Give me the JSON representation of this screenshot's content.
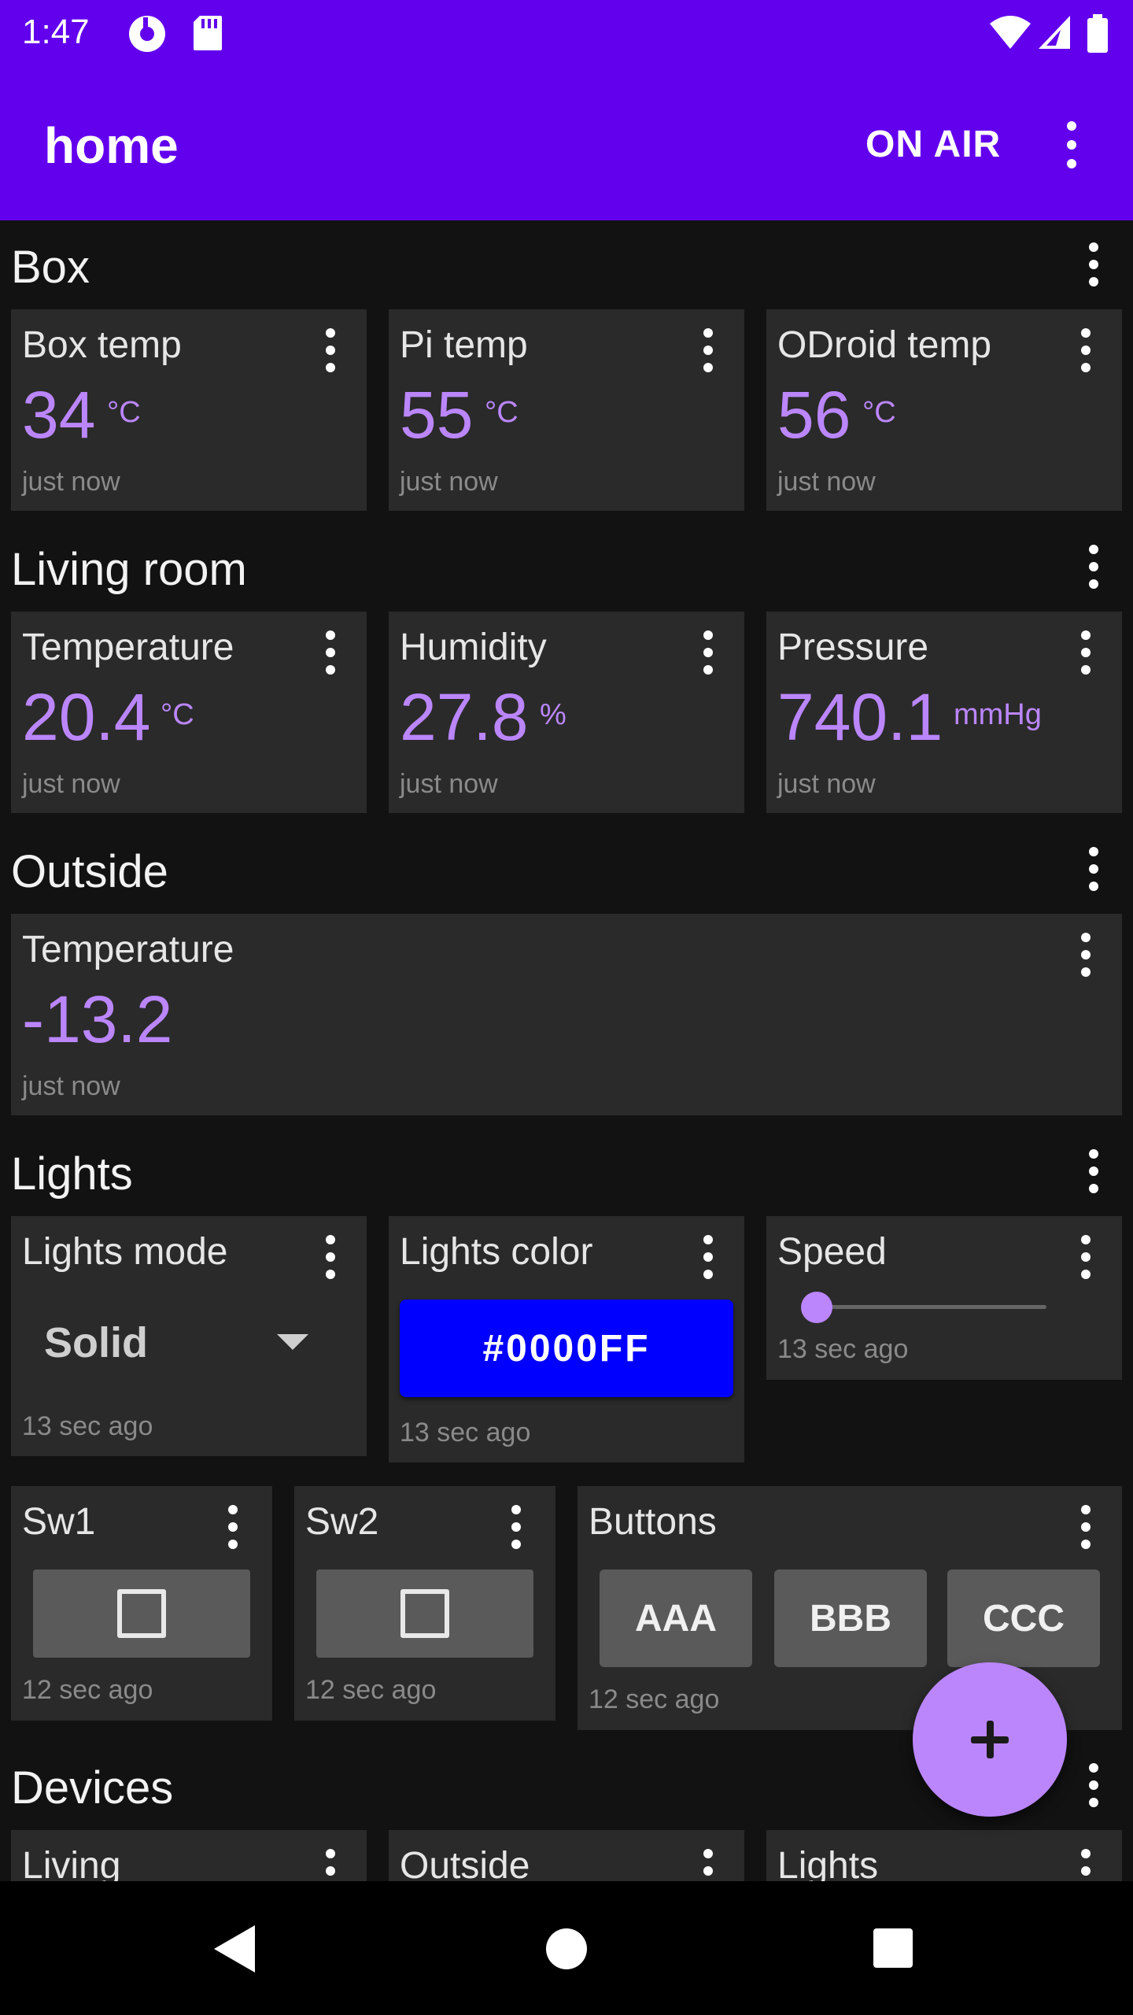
{
  "status_bar": {
    "time": "1:47",
    "icons": [
      "pocket-casts-icon",
      "sd-card-icon",
      "wifi-icon",
      "cell-signal-icon",
      "battery-icon"
    ]
  },
  "app_bar": {
    "title": "home",
    "action_label": "ON AIR",
    "menu_icon": "more-vert-icon"
  },
  "sections": {
    "box": {
      "title": "Box",
      "cards": [
        {
          "title": "Box temp",
          "value": "34",
          "unit": "°C",
          "updated": "just now"
        },
        {
          "title": "Pi temp",
          "value": "55",
          "unit": "°C",
          "updated": "just now"
        },
        {
          "title": "ODroid temp",
          "value": "56",
          "unit": "°C",
          "updated": "just now"
        }
      ]
    },
    "living_room": {
      "title": "Living room",
      "cards": [
        {
          "title": "Temperature",
          "value": "20.4",
          "unit": "°C",
          "updated": "just now"
        },
        {
          "title": "Humidity",
          "value": "27.8",
          "unit": "%",
          "updated": "just now"
        },
        {
          "title": "Pressure",
          "value": "740.1",
          "unit": "mmHg",
          "updated": "just now"
        }
      ]
    },
    "outside": {
      "title": "Outside",
      "cards": [
        {
          "title": "Temperature",
          "value": "-13.2",
          "updated": "just now"
        }
      ]
    },
    "lights": {
      "title": "Lights",
      "mode": {
        "title": "Lights mode",
        "selected": "Solid",
        "updated": "13 sec ago"
      },
      "color": {
        "title": "Lights color",
        "value": "#0000FF",
        "updated": "13 sec ago"
      },
      "speed": {
        "title": "Speed",
        "level": 0,
        "updated": "13 sec ago"
      },
      "sw1": {
        "title": "Sw1",
        "checked": false,
        "updated": "12 sec ago"
      },
      "sw2": {
        "title": "Sw2",
        "checked": false,
        "updated": "12 sec ago"
      },
      "buttons": {
        "title": "Buttons",
        "labels": [
          "AAA",
          "BBB",
          "CCC"
        ],
        "updated": "12 sec ago"
      }
    },
    "devices": {
      "title": "Devices",
      "cards": [
        {
          "title": "Living"
        },
        {
          "title": "Outside"
        },
        {
          "title": "Lights"
        }
      ]
    }
  },
  "fab": {
    "icon": "plus-icon"
  },
  "nav_bar": {
    "icons": [
      "back-icon",
      "home-icon",
      "recents-icon"
    ]
  },
  "colors": {
    "primary": "#6200ee",
    "accent": "#bb86fc",
    "background": "#121212",
    "card": "#2a2a2a"
  }
}
